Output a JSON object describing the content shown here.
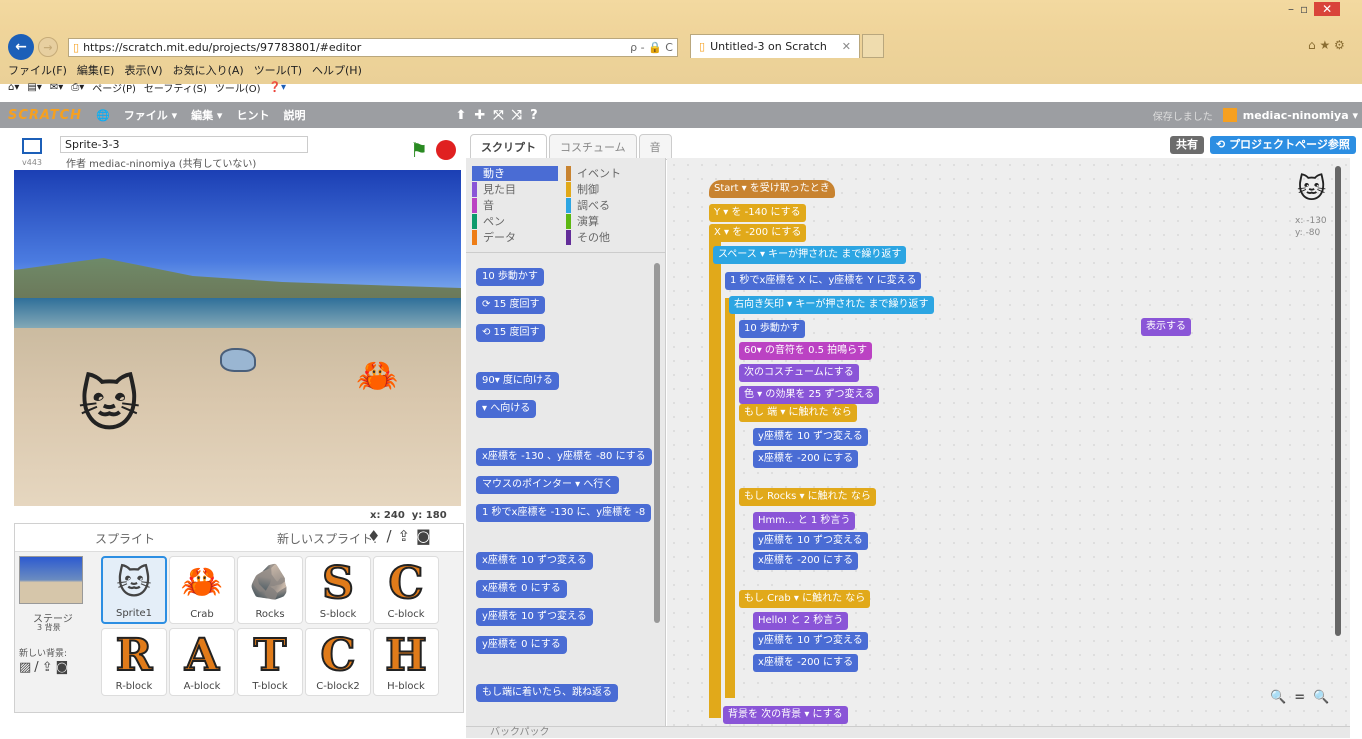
{
  "browser": {
    "url": "https://scratch.mit.edu/projects/97783801/#editor",
    "tab_title": "Untitled-3 on Scratch",
    "search_hint": "ρ - 🔒 C",
    "menus": [
      "ファイル(F)",
      "編集(E)",
      "表示(V)",
      "お気に入り(A)",
      "ツール(T)",
      "ヘルプ(H)"
    ],
    "commands": [
      "ページ(P)",
      "セーフティ(S)",
      "ツール(O)"
    ]
  },
  "scratch": {
    "logo": "SCRATCH",
    "menu": [
      "ファイル ▾",
      "編集 ▾",
      "ヒント",
      "説明"
    ],
    "saved": "保存しました",
    "user": "mediac-ninomiya ▾",
    "share": "共有",
    "project_page": "プロジェクトページ参照"
  },
  "stage": {
    "sprite_name": "Sprite-3-3",
    "version": "v443",
    "author": "作者 mediac-ninomiya (共有していない)",
    "mouse_x": "x: 240",
    "mouse_y": "y: 180"
  },
  "sprites_panel": {
    "title": "スプライト",
    "new_sprite": "新しいスプライト:",
    "stage_label": "ステージ",
    "stage_sub": "3 背景",
    "new_backdrop": "新しい背景:",
    "sprites": [
      {
        "name": "Sprite1",
        "glyph": "🐱"
      },
      {
        "name": "Crab",
        "glyph": "🦀"
      },
      {
        "name": "Rocks",
        "glyph": "🪨"
      },
      {
        "name": "S-block",
        "glyph": "S"
      },
      {
        "name": "C-block",
        "glyph": "C"
      },
      {
        "name": "R-block",
        "glyph": "R"
      },
      {
        "name": "A-block",
        "glyph": "A"
      },
      {
        "name": "T-block",
        "glyph": "T"
      },
      {
        "name": "C-block2",
        "glyph": "C"
      },
      {
        "name": "H-block",
        "glyph": "H"
      }
    ]
  },
  "tabs": [
    "スクリプト",
    "コスチューム",
    "音"
  ],
  "categories": [
    {
      "label": "動き",
      "color": "#4a6cd4"
    },
    {
      "label": "イベント",
      "color": "#c88330"
    },
    {
      "label": "見た目",
      "color": "#8a55d7"
    },
    {
      "label": "制御",
      "color": "#e1a91a"
    },
    {
      "label": "音",
      "color": "#bb42c3"
    },
    {
      "label": "調べる",
      "color": "#2ca5e2"
    },
    {
      "label": "ペン",
      "color": "#0e9a6c"
    },
    {
      "label": "演算",
      "color": "#5cb712"
    },
    {
      "label": "データ",
      "color": "#ee7d16"
    },
    {
      "label": "その他",
      "color": "#632d99"
    }
  ],
  "palette_blocks": [
    "10 歩動かす",
    "⟳ 15 度回す",
    "⟲ 15 度回す",
    "90▾ 度に向ける",
    "▾ へ向ける",
    "x座標を -130 、y座標を -80 にする",
    "マウスのポインター ▾ へ行く",
    "1 秒でx座標を -130 に、y座標を -8",
    "x座標を 10 ずつ変える",
    "x座標を 0 にする",
    "y座標を 10 ずつ変える",
    "y座標を 0 にする",
    "もし端に着いたら、跳ね返る"
  ],
  "script_blocks": [
    "Start ▾ を受け取ったとき",
    "Y ▾ を -140 にする",
    "X ▾ を -200 にする",
    "スペース ▾ キーが押された まで繰り返す",
    "1 秒でx座標を X に、y座標を Y に変える",
    "右向き矢印 ▾ キーが押された まで繰り返す",
    "10 歩動かす",
    "60▾ の音符を 0.5 拍鳴らす",
    "次のコスチュームにする",
    "色 ▾ の効果を 25 ずつ変える",
    "もし 端 ▾ に触れた なら",
    "y座標を 10 ずつ変える",
    "x座標を -200 にする",
    "もし Rocks ▾ に触れた なら",
    "Hmm... と 1 秒言う",
    "y座標を 10 ずつ変える",
    "x座標を -200 にする",
    "もし Crab ▾ に触れた なら",
    "Hello! と 2 秒言う",
    "y座標を 10 ずつ変える",
    "x座標を -200 にする",
    "背景を 次の背景 ▾ にする",
    "表示する"
  ],
  "sprite_info": {
    "x": "x: -130",
    "y": "y: -80"
  },
  "backpack": "バックパック"
}
